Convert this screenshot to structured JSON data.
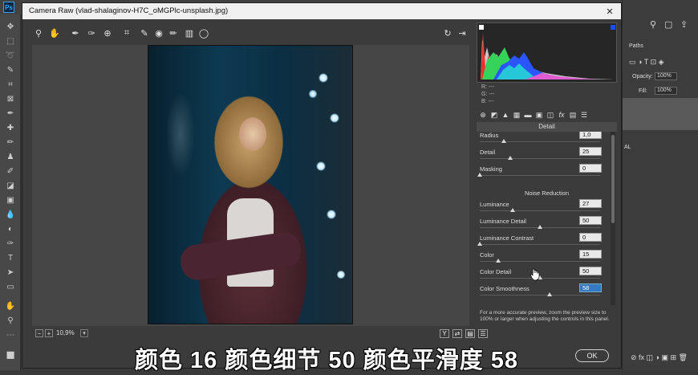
{
  "dialog": {
    "title": "Camera Raw (vlad-shalaginov-H7C_oMGPlc-unsplash.jpg)",
    "close_glyph": "✕"
  },
  "toolbar": {
    "tools": [
      "zoom-icon",
      "hand-icon",
      "white-balance-icon",
      "color-sampler-icon",
      "targeted-adjustment-icon",
      "crop-icon",
      "spot-removal-icon",
      "red-eye-icon",
      "adjustment-brush-icon",
      "graduated-filter-icon",
      "radial-filter-icon"
    ],
    "right": [
      "rotate-icon",
      "open-image-icon"
    ]
  },
  "preview": {
    "zoom_value": "10,9%"
  },
  "readout": {
    "r_label": "R:",
    "r_value": "---",
    "g_label": "G:",
    "g_value": "---",
    "b_label": "B:",
    "b_value": "---"
  },
  "panel": {
    "header": "Detail",
    "sharpening": [
      {
        "label": "Radius",
        "value": "1,0",
        "fraction": 0.2
      },
      {
        "label": "Detail",
        "value": "25",
        "fraction": 0.25
      },
      {
        "label": "Masking",
        "value": "0",
        "fraction": 0.0
      }
    ],
    "noise_section": "Noise Reduction",
    "noise": [
      {
        "label": "Luminance",
        "value": "27",
        "fraction": 0.27
      },
      {
        "label": "Luminance Detail",
        "value": "50",
        "fraction": 0.5
      },
      {
        "label": "Luminance Contrast",
        "value": "0",
        "fraction": 0.0
      },
      {
        "label": "Color",
        "value": "15",
        "fraction": 0.15
      },
      {
        "label": "Color Detail",
        "value": "50",
        "fraction": 0.5
      },
      {
        "label": "Color Smoothness",
        "value": "58",
        "fraction": 0.58
      }
    ]
  },
  "note": "For a more accurate preview, zoom the preview size to 100% or larger when adjusting the controls in this panel.",
  "ok_label": "OK",
  "subtitle": "颜色 16 颜色细节 50 颜色平滑度 58",
  "ps_panel": {
    "paths": "Paths",
    "opacity_label": "Opacity:",
    "opacity_value": "100%",
    "fill_label": "Fill:",
    "fill_value": "100%",
    "layer_text": "AL"
  },
  "colors": {
    "accent": "#3478c6",
    "histogram_red": "#e8362f",
    "histogram_green": "#35d35a",
    "histogram_blue": "#2a55ff"
  }
}
